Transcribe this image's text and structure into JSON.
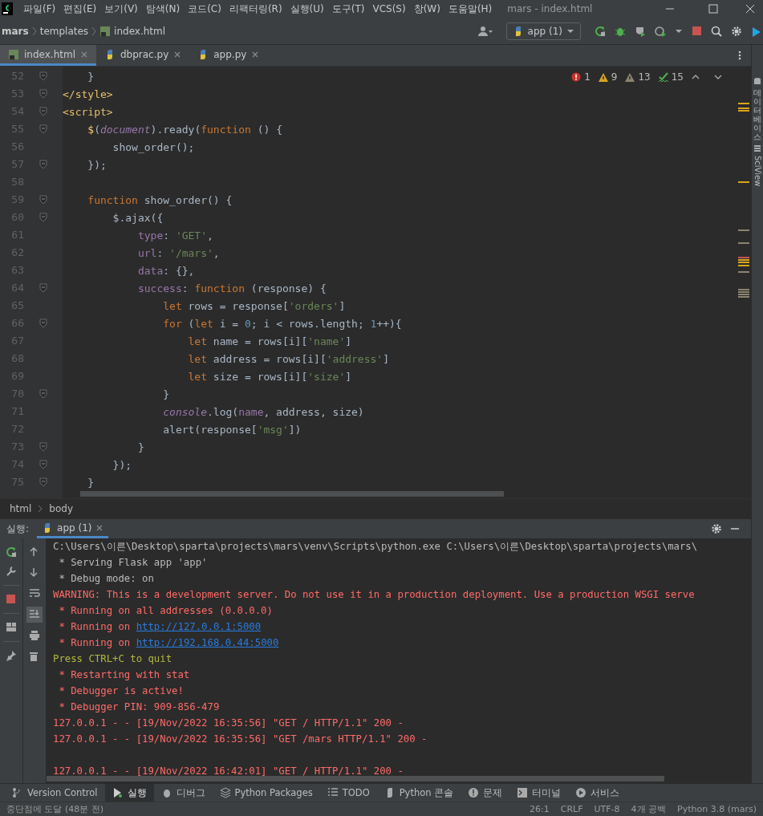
{
  "menu": {
    "items": [
      "파일(F)",
      "편집(E)",
      "보기(V)",
      "탐색(N)",
      "코드(C)",
      "리팩터링(R)",
      "실행(U)",
      "도구(T)",
      "VCS(S)",
      "창(W)",
      "도움말(H)"
    ],
    "title": "mars - index.html"
  },
  "navbar": {
    "crumbs": [
      "mars",
      "templates",
      "index.html"
    ],
    "run_config": "app (1)"
  },
  "tabs": [
    {
      "label": "index.html",
      "kind": "html",
      "selected": true
    },
    {
      "label": "dbprac.py",
      "kind": "py",
      "selected": false
    },
    {
      "label": "app.py",
      "kind": "py",
      "selected": false
    }
  ],
  "inspections": {
    "errors": "1",
    "warnings": "9",
    "weak_warnings": "13",
    "typos": "15"
  },
  "code": [
    {
      "n": "52",
      "t": [
        {
          "kind": "p",
          "text": "    }"
        }
      ]
    },
    {
      "n": "53",
      "t": [
        {
          "kind": "tag",
          "text": "</style>"
        }
      ]
    },
    {
      "n": "54",
      "t": [
        {
          "kind": "tag",
          "text": "<script>"
        }
      ]
    },
    {
      "n": "55",
      "t": [
        {
          "kind": "fn",
          "text": "    $"
        },
        {
          "kind": "p",
          "text": "("
        },
        {
          "kind": "it",
          "text": "document"
        },
        {
          "kind": "p",
          "text": ").ready("
        },
        {
          "kind": "kw",
          "text": "function"
        },
        {
          "kind": "p",
          "text": " () {"
        }
      ]
    },
    {
      "n": "56",
      "t": [
        {
          "kind": "p",
          "text": "        show_order();"
        }
      ]
    },
    {
      "n": "57",
      "t": [
        {
          "kind": "p",
          "text": "    });"
        }
      ]
    },
    {
      "n": "58"
    },
    {
      "n": "59",
      "t": [
        {
          "kind": "kw",
          "text": "    function"
        },
        {
          "kind": "p",
          "text": " show_order() {"
        }
      ]
    },
    {
      "n": "60",
      "t": [
        {
          "kind": "p",
          "text": "        $.ajax({"
        }
      ]
    },
    {
      "n": "61",
      "t": [
        {
          "kind": "prop",
          "text": "            type"
        },
        {
          "kind": "p",
          "text": ": "
        },
        {
          "kind": "str",
          "text": "'GET'"
        },
        {
          "kind": "p",
          "text": ","
        }
      ]
    },
    {
      "n": "62",
      "t": [
        {
          "kind": "prop",
          "text": "            url"
        },
        {
          "kind": "p",
          "text": ": "
        },
        {
          "kind": "str",
          "text": "'/mars'"
        },
        {
          "kind": "p",
          "text": ","
        }
      ]
    },
    {
      "n": "63",
      "t": [
        {
          "kind": "prop",
          "text": "            data"
        },
        {
          "kind": "p",
          "text": ": {},"
        }
      ]
    },
    {
      "n": "64",
      "t": [
        {
          "kind": "prop",
          "text": "            success"
        },
        {
          "kind": "p",
          "text": ": "
        },
        {
          "kind": "kw",
          "text": "function"
        },
        {
          "kind": "p",
          "text": " (response) {"
        }
      ]
    },
    {
      "n": "65",
      "t": [
        {
          "kind": "kw",
          "text": "                let"
        },
        {
          "kind": "p",
          "text": " rows = response["
        },
        {
          "kind": "str",
          "text": "'orders'"
        },
        {
          "kind": "p",
          "text": "]"
        }
      ]
    },
    {
      "n": "66",
      "t": [
        {
          "kind": "kw",
          "text": "                for"
        },
        {
          "kind": "p",
          "text": " ("
        },
        {
          "kind": "kw",
          "text": "let"
        },
        {
          "kind": "p",
          "text": " i = "
        },
        {
          "kind": "num",
          "text": "0"
        },
        {
          "kind": "p",
          "text": "; i < rows.length; "
        },
        {
          "kind": "num",
          "text": "1"
        },
        {
          "kind": "p",
          "text": "++){"
        }
      ]
    },
    {
      "n": "67",
      "t": [
        {
          "kind": "kw",
          "text": "                    let"
        },
        {
          "kind": "p",
          "text": " name = rows[i]["
        },
        {
          "kind": "str",
          "text": "'name'"
        },
        {
          "kind": "p",
          "text": "]"
        }
      ]
    },
    {
      "n": "68",
      "t": [
        {
          "kind": "kw",
          "text": "                    let"
        },
        {
          "kind": "p",
          "text": " address = rows[i]["
        },
        {
          "kind": "str",
          "text": "'address'"
        },
        {
          "kind": "p",
          "text": "]"
        }
      ]
    },
    {
      "n": "69",
      "t": [
        {
          "kind": "kw",
          "text": "                    let"
        },
        {
          "kind": "p",
          "text": " size = rows[i]["
        },
        {
          "kind": "str",
          "text": "'size'"
        },
        {
          "kind": "p",
          "text": "]"
        }
      ]
    },
    {
      "n": "70",
      "t": [
        {
          "kind": "p",
          "text": "                }"
        }
      ]
    },
    {
      "n": "71",
      "t": [
        {
          "kind": "it",
          "text": "                console"
        },
        {
          "kind": "p",
          "text": ".log("
        },
        {
          "kind": "prop",
          "text": "name"
        },
        {
          "kind": "p",
          "text": ", address, size)"
        }
      ]
    },
    {
      "n": "72",
      "t": [
        {
          "kind": "p",
          "text": "                alert(response["
        },
        {
          "kind": "str",
          "text": "'msg'"
        },
        {
          "kind": "p",
          "text": "])"
        }
      ]
    },
    {
      "n": "73",
      "t": [
        {
          "kind": "p",
          "text": "            }"
        }
      ]
    },
    {
      "n": "74",
      "t": [
        {
          "kind": "p",
          "text": "        });"
        }
      ]
    },
    {
      "n": "75",
      "t": [
        {
          "kind": "p",
          "text": "    }"
        }
      ]
    }
  ],
  "breadcrumb": [
    "html",
    "body"
  ],
  "run_panel": {
    "label": "실행:",
    "tab": "app (1)"
  },
  "console": [
    [
      {
        "kind": "plain",
        "text": "C:\\Users\\이른\\Desktop\\sparta\\projects\\mars\\venv\\Scripts\\python.exe C:\\Users\\이른\\Desktop\\sparta\\projects\\mars\\"
      }
    ],
    [
      {
        "kind": "plain",
        "text": " * Serving Flask app 'app'"
      }
    ],
    [
      {
        "kind": "plain",
        "text": " * Debug mode: on"
      }
    ],
    [
      {
        "kind": "err",
        "text": "WARNING: This is a development server. Do not use it in a production deployment. Use a production WSGI serve"
      }
    ],
    [
      {
        "kind": "err",
        "text": " * Running on all addresses (0.0.0.0)"
      }
    ],
    [
      {
        "kind": "err",
        "text": " * Running on "
      },
      {
        "kind": "link",
        "text": "http://127.0.0.1:5000"
      }
    ],
    [
      {
        "kind": "err",
        "text": " * Running on "
      },
      {
        "kind": "link",
        "text": "http://192.168.0.44:5000"
      }
    ],
    [
      {
        "kind": "info",
        "text": "Press CTRL+C to quit"
      }
    ],
    [
      {
        "kind": "err",
        "text": " * Restarting with stat"
      }
    ],
    [
      {
        "kind": "err",
        "text": " * Debugger is active!"
      }
    ],
    [
      {
        "kind": "err",
        "text": " * Debugger PIN: 909-856-479"
      }
    ],
    [
      {
        "kind": "err",
        "text": "127.0.0.1 - - [19/Nov/2022 16:35:56] \"GET / HTTP/1.1\" 200 -"
      }
    ],
    [
      {
        "kind": "err",
        "text": "127.0.0.1 - - [19/Nov/2022 16:35:56] \"GET /mars HTTP/1.1\" 200 -"
      }
    ],
    [
      {
        "kind": "err",
        "text": "127.0.0.1 - - [19/Nov/2022 16:42:01] \"GET / HTTP/1.1\" 200 -",
        "gap_before": true
      }
    ]
  ],
  "toolwindows": [
    {
      "label": "Version Control",
      "kind": "vcs",
      "selected": false
    },
    {
      "label": "실행",
      "kind": "run",
      "selected": true
    },
    {
      "label": "디버그",
      "kind": "debug",
      "selected": false
    },
    {
      "label": "Python Packages",
      "kind": "packages",
      "selected": false
    },
    {
      "label": "TODO",
      "kind": "todo",
      "selected": false
    },
    {
      "label": "Python 콘솔",
      "kind": "pyconsole",
      "selected": false
    },
    {
      "label": "문제",
      "kind": "problems",
      "selected": false
    },
    {
      "label": "터미널",
      "kind": "terminal",
      "selected": false
    },
    {
      "label": "서비스",
      "kind": "services",
      "selected": false
    }
  ],
  "side_labels": {
    "database": "데이터베이스",
    "sciview": "SciView"
  },
  "status_bar": {
    "message": "중단점에 도달 (48분 전)",
    "items": [
      "26:1",
      "CRLF",
      "UTF-8",
      "4개 공백",
      "Python 3.8 (mars)"
    ]
  }
}
